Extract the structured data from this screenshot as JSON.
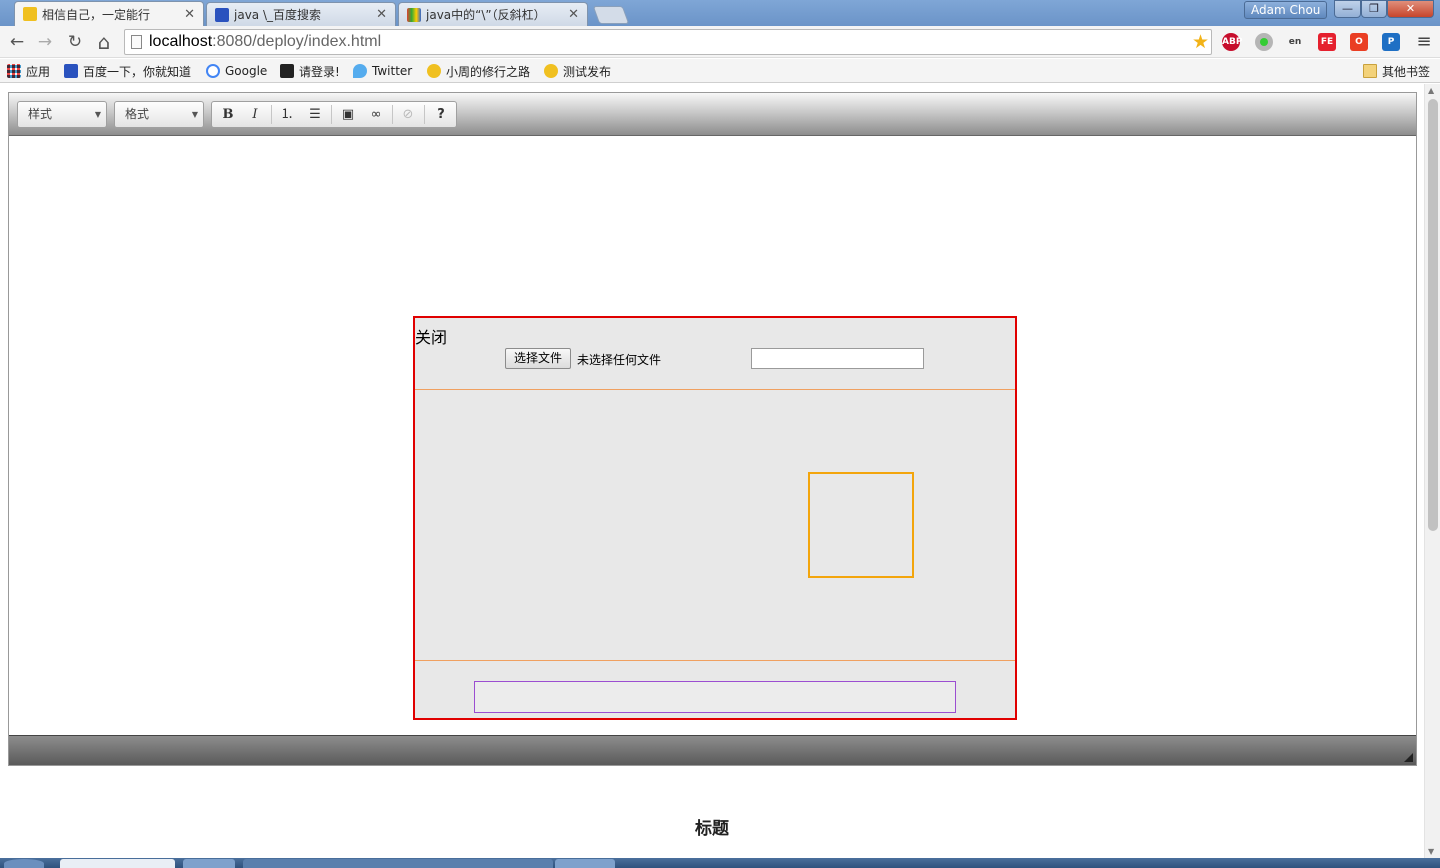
{
  "browser": {
    "tabs": [
      {
        "title": "相信自己，一定能行",
        "active": true,
        "icon": "sun-favicon",
        "color": "#f0c020"
      },
      {
        "title": "java \\_百度搜索",
        "active": false,
        "icon": "baidu-paw-favicon",
        "color": "#2a52be"
      },
      {
        "title": "java中的“\\”（反斜杠）",
        "active": false,
        "icon": "colorful-favicon",
        "color": "#d43"
      }
    ],
    "profile_name": "Adam Chou",
    "window_buttons": {
      "minimize": "—",
      "maximize": "❐",
      "close": "✕"
    },
    "nav": {
      "back": "←",
      "forward": "→",
      "reload": "↻",
      "home": "⌂"
    },
    "url": {
      "host": "localhost",
      "path": ":8080/deploy/index.html"
    },
    "extensions": [
      {
        "name": "adblock-plus-icon",
        "label": "ABP",
        "color": "#c70d2c"
      },
      {
        "name": "green-dot-icon",
        "label": "",
        "color": "#9a9a9a"
      },
      {
        "name": "translate-icon",
        "label": "en",
        "color": "#555555"
      },
      {
        "name": "fe-helper-icon",
        "label": "FE",
        "color": "#e5202e"
      },
      {
        "name": "office-icon",
        "label": "O",
        "color": "#ea3e23"
      },
      {
        "name": "pushbullet-icon",
        "label": "P",
        "color": "#1e6fc4"
      }
    ],
    "menu_icon": "≡"
  },
  "bookmarks": {
    "items": [
      {
        "label": "应用",
        "icon": "apps-grid-icon",
        "color": "#e44"
      },
      {
        "label": "百度一下，你就知道",
        "icon": "baidu-paw-icon",
        "color": "#2a52be"
      },
      {
        "label": "Google",
        "icon": "google-g-icon",
        "color": "#4285f4"
      },
      {
        "label": "请登录!",
        "icon": "bird-icon",
        "color": "#222222"
      },
      {
        "label": "Twitter",
        "icon": "twitter-bird-icon",
        "color": "#55acee"
      },
      {
        "label": "小周的修行之路",
        "icon": "sun-icon",
        "color": "#f0c020"
      },
      {
        "label": "测试发布",
        "icon": "sun-icon",
        "color": "#f0c020"
      }
    ],
    "other": "其他书签"
  },
  "editor": {
    "style_combo": "样式",
    "format_combo": "格式",
    "buttons": {
      "bold": "B",
      "italic": "I",
      "numbered_list": "⒈",
      "bulleted_list": "☰",
      "image": "▣",
      "link": "∞",
      "unlink": "⊘",
      "help": "?"
    }
  },
  "dialog": {
    "close_label": "关闭",
    "file_button_label": "选择文件",
    "file_status": "未选择任何文件",
    "name_value": "",
    "result_value": ""
  },
  "page": {
    "heading": "标题"
  }
}
